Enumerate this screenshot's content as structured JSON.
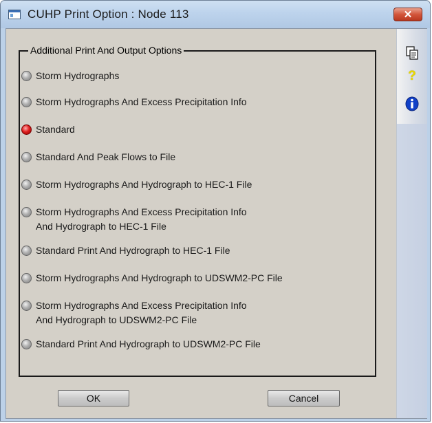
{
  "window": {
    "title": "CUHP Print Option : Node 113",
    "close_label": "✕"
  },
  "group": {
    "title": "Additional Print And Output Options"
  },
  "options": [
    {
      "lines": [
        "Storm Hydrographs"
      ],
      "selected": false
    },
    {
      "lines": [
        "Storm Hydrographs And Excess Precipitation Info"
      ],
      "selected": false
    },
    {
      "lines": [
        "Standard"
      ],
      "selected": true
    },
    {
      "lines": [
        "Standard And Peak Flows to File"
      ],
      "selected": false
    },
    {
      "lines": [
        "Storm Hydrographs And Hydrograph to HEC-1 File"
      ],
      "selected": false
    },
    {
      "lines": [
        "Storm Hydrographs And Excess Precipitation Info",
        "And Hydrograph to HEC-1 File"
      ],
      "selected": false
    },
    {
      "lines": [
        "Standard Print And Hydrograph to HEC-1 File"
      ],
      "selected": false
    },
    {
      "lines": [
        "Storm Hydrographs And Hydrograph to UDSWM2-PC File"
      ],
      "selected": false
    },
    {
      "lines": [
        "Storm Hydrographs And Excess Precipitation Info",
        "And Hydrograph to UDSWM2-PC File"
      ],
      "selected": false
    },
    {
      "lines": [
        "Standard Print And Hydrograph to UDSWM2-PC File"
      ],
      "selected": false
    }
  ],
  "buttons": {
    "ok": "OK",
    "cancel": "Cancel"
  },
  "side_icons": {
    "copy": "copy-icon",
    "help": "?",
    "info": "info-icon"
  },
  "colors": {
    "selected_radio": "#e02020",
    "client_background": "#d4d0c8"
  }
}
